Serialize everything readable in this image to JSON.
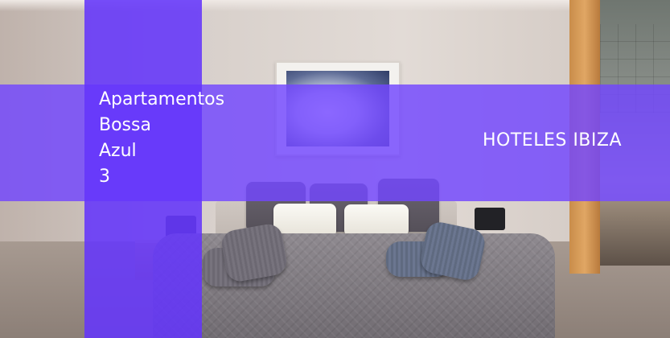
{
  "hotel": {
    "name_lines": [
      "Apartamentos",
      "Bossa",
      "Azul",
      "3"
    ]
  },
  "brand": {
    "label": "HOTELES IBIZA"
  },
  "colors": {
    "overlay": "#7246ff",
    "overlay_column": "#6436fa",
    "text": "#ffffff"
  }
}
